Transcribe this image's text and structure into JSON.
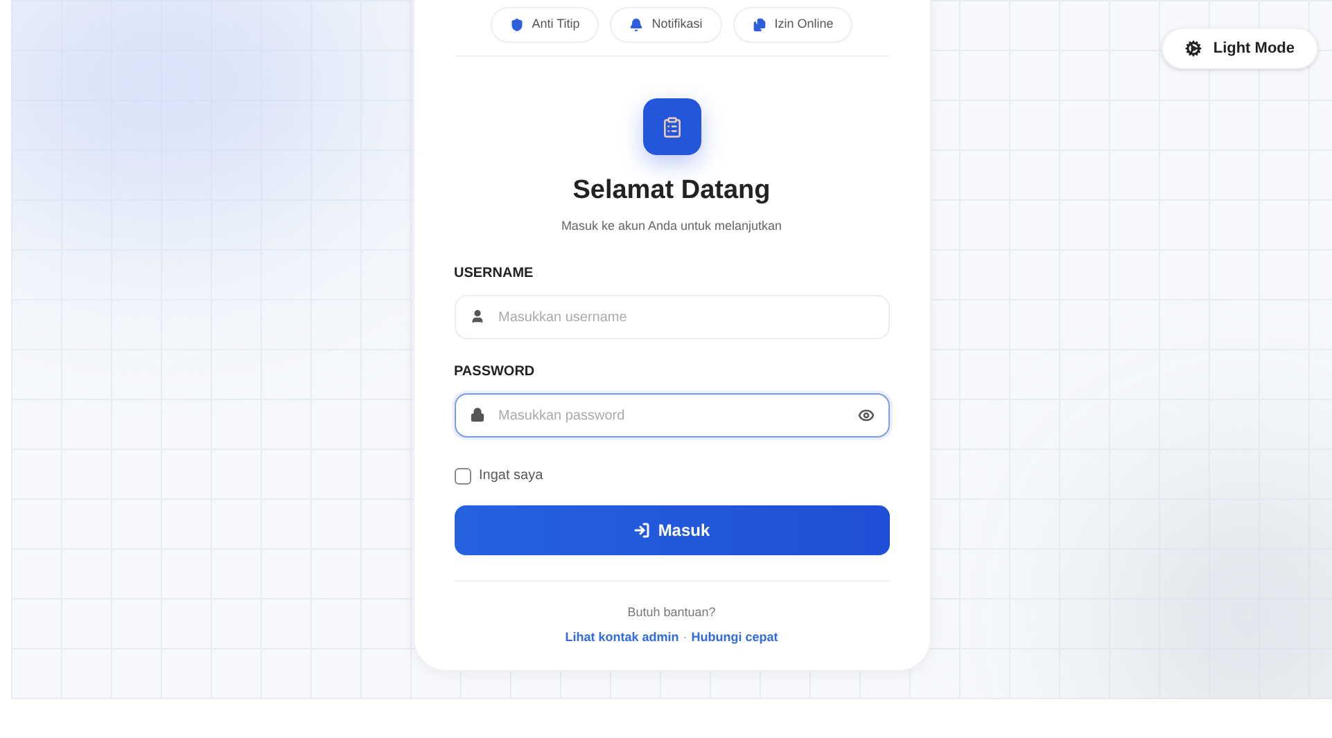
{
  "theme_toggle": {
    "label": "Light Mode"
  },
  "features": [
    {
      "kind": "shield",
      "label": "Anti Titip"
    },
    {
      "kind": "bell",
      "label": "Notifikasi"
    },
    {
      "kind": "files",
      "label": "Izin Online"
    }
  ],
  "title": "Selamat Datang",
  "subtitle": "Masuk ke akun Anda untuk melanjutkan",
  "fields": [
    {
      "kind": "user",
      "label": "USERNAME",
      "placeholder": "Masukkan username",
      "focused": false
    },
    {
      "kind": "lock",
      "label": "PASSWORD",
      "placeholder": "Masukkan password",
      "focused": true
    }
  ],
  "remember": {
    "label": "Ingat saya",
    "checked": false
  },
  "submit": {
    "label": "Masuk"
  },
  "help": {
    "text": "Butuh bantuan?",
    "links": [
      "Lihat kontak admin",
      "Hubungi cepat"
    ],
    "separator": "·"
  }
}
